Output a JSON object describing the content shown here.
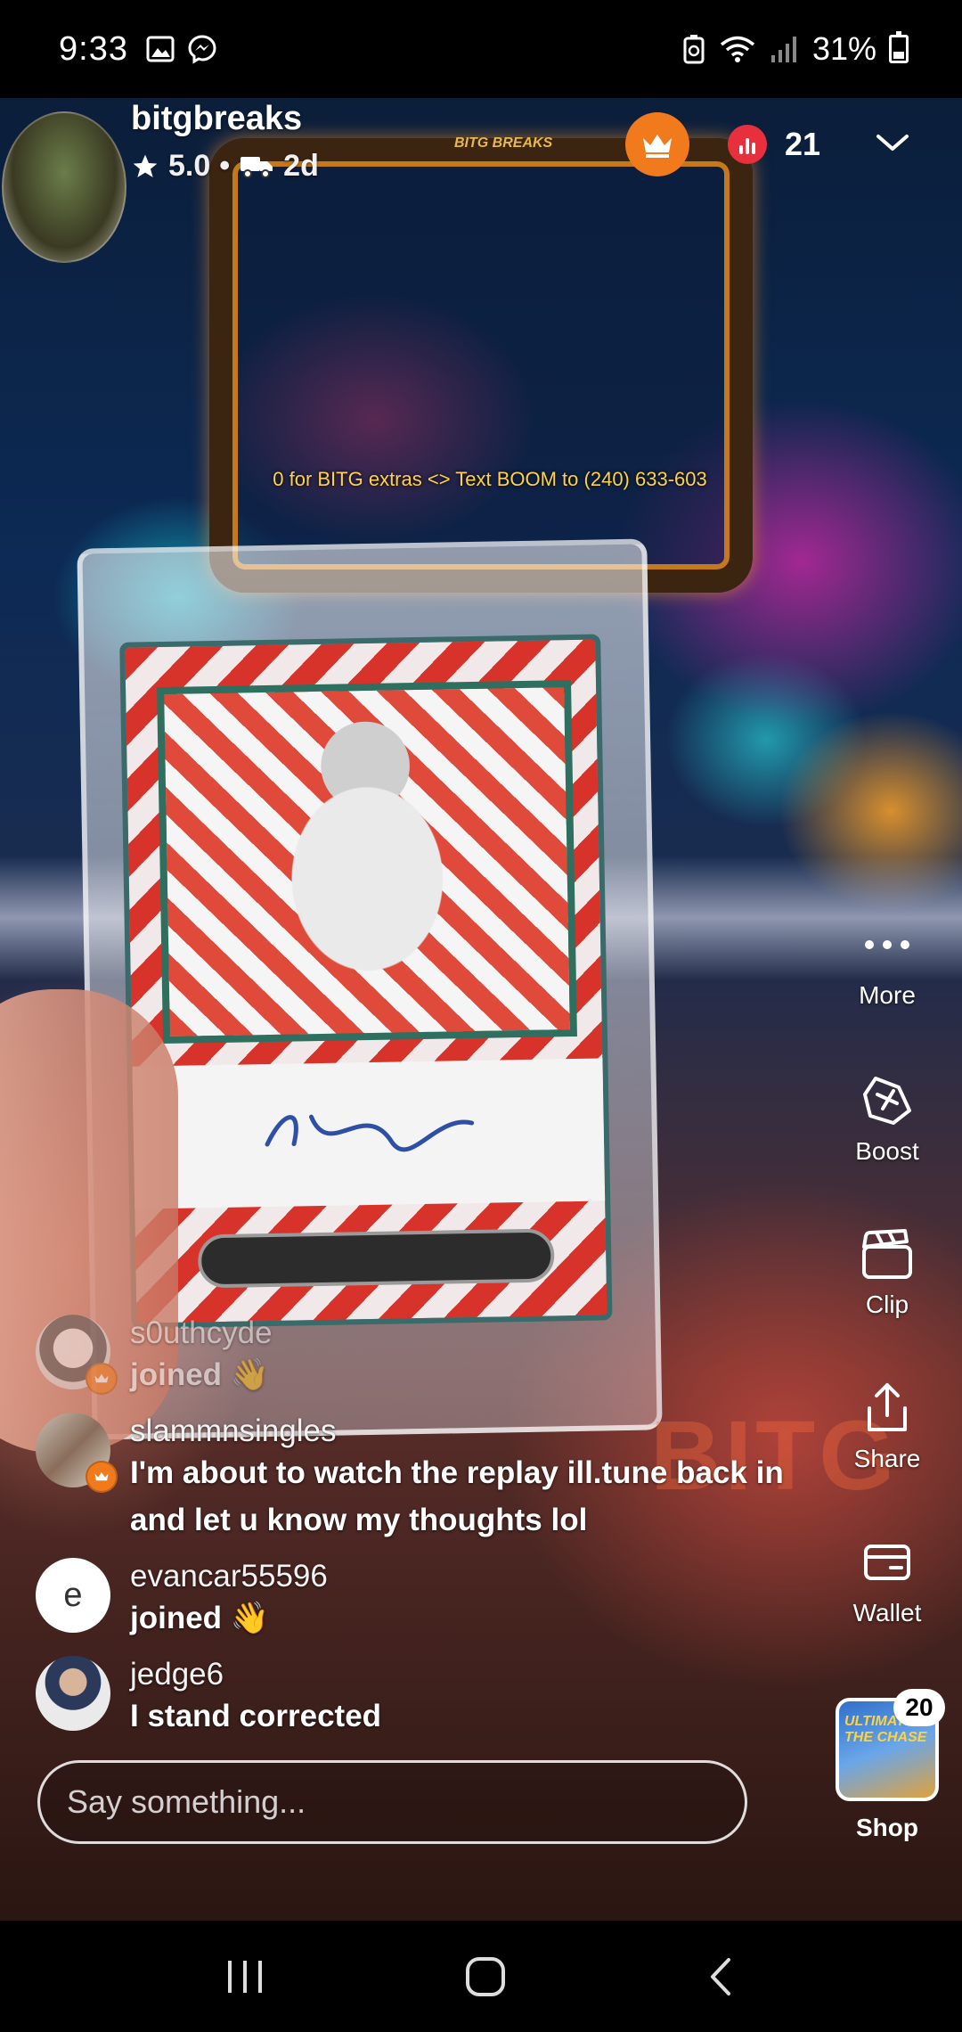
{
  "status_bar": {
    "time": "9:33",
    "battery": "31%"
  },
  "host": {
    "name": "bitgbreaks",
    "rating": "5.0",
    "separator": "•",
    "shipping": "2d"
  },
  "viewers": {
    "count": "21"
  },
  "stream_overlay": {
    "ticker": "0 for BITG extras  <>  Text BOOM to (240) 633-603",
    "logo_text": "BITG BREAKS"
  },
  "right_rail": {
    "more": "More",
    "boost": "Boost",
    "clip": "Clip",
    "share": "Share",
    "wallet": "Wallet",
    "shop": "Shop",
    "shop_badge": "20",
    "shop_thumb_text": "ULTIMATE THE CHASE"
  },
  "chat": [
    {
      "user": "s0uthcyde",
      "text": "joined 👋"
    },
    {
      "user": "slammnsingles",
      "text": "I'm about to watch the replay ill.tune back in and let u know my thoughts lol"
    },
    {
      "user": "evancar55596",
      "initial": "e",
      "text": "joined 👋"
    },
    {
      "user": "jedge6",
      "text": "I stand corrected"
    }
  ],
  "input": {
    "placeholder": "Say something..."
  },
  "colors": {
    "accent_orange": "#f07a1c",
    "live_red": "#e8303d"
  }
}
